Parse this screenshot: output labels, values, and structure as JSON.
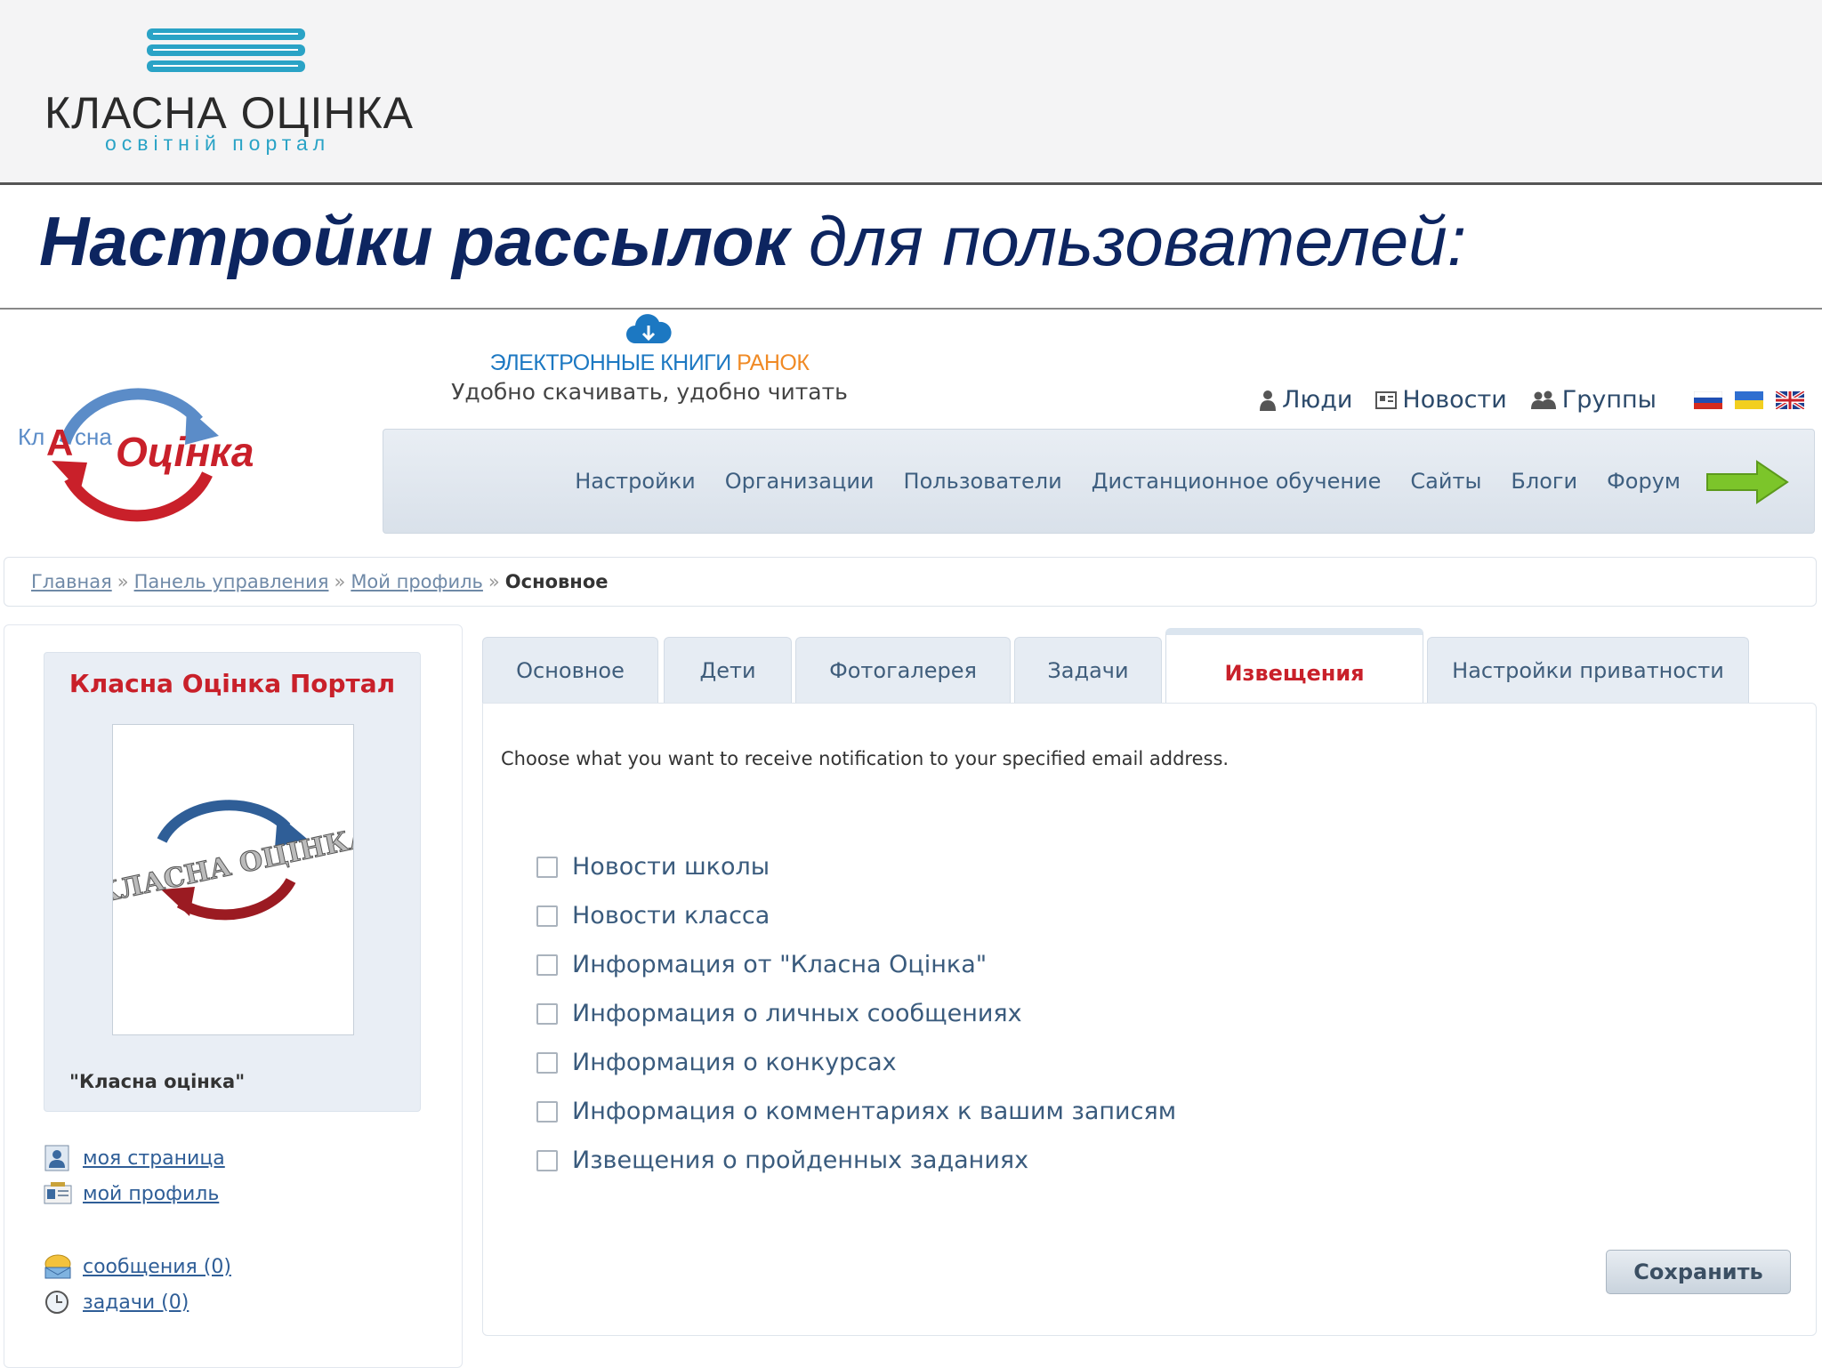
{
  "brand": {
    "name": "КЛАСНА ОЦІНКА",
    "tagline": "освітній портал"
  },
  "slide": {
    "title_bold": "Настройки рассылок",
    "title_rest": " для пользователей:"
  },
  "banner": {
    "line1_main": "ЭЛЕКТРОННЫЕ КНИГИ ",
    "line1_accent": "РАНОК",
    "line2": "Удобно скачивать, удобно читать"
  },
  "site_logo": {
    "part1": "Кл",
    "part2": "А",
    "part3": "сна",
    "part4": "Оцінка"
  },
  "topnav": {
    "people": "Люди",
    "news": "Новости",
    "groups": "Группы"
  },
  "menu": [
    "Настройки",
    "Организации",
    "Пользователи",
    "Дистанционное обучение",
    "Сайты",
    "Блоги",
    "Форум"
  ],
  "breadcrumb": {
    "home": "Главная",
    "panel": "Панель управления",
    "profile": "Мой профиль",
    "current": "Основное",
    "separator": "»"
  },
  "profile": {
    "name": "Класна Оцінка Портал",
    "caption": "\"Класна оцінка\"",
    "photo_text": "КЛАСНА ОЦІНКА"
  },
  "sidebar_links": {
    "my_page": "моя страница",
    "my_profile": "мой профиль",
    "messages": "сообщения (0)",
    "tasks": "задачи (0)"
  },
  "tabs": [
    "Основное",
    "Дети",
    "Фотогалерея",
    "Задачи",
    "Извещения",
    "Настройки приватности"
  ],
  "active_tab": "Извещения",
  "content": {
    "intro": "Choose what you want to receive notification to your specified email address.",
    "options": [
      {
        "label": "Новости школы",
        "checked": false
      },
      {
        "label": "Новости класса",
        "checked": false
      },
      {
        "label": "Информация от \"Класна Оцінка\"",
        "checked": false
      },
      {
        "label": "Информация о личных сообщениях",
        "checked": false
      },
      {
        "label": "Информация о конкурсах",
        "checked": false
      },
      {
        "label": "Информация о комментариях к вашим записям",
        "checked": false
      },
      {
        "label": "Извещения о пройденных заданиях",
        "checked": false
      }
    ],
    "save_label": "Сохранить"
  },
  "colors": {
    "title_navy": "#0d2560",
    "accent_red": "#c9202a",
    "link_blue": "#2f5e97",
    "brand_teal": "#2aa3c6",
    "arrow_green": "#7cc52a"
  }
}
